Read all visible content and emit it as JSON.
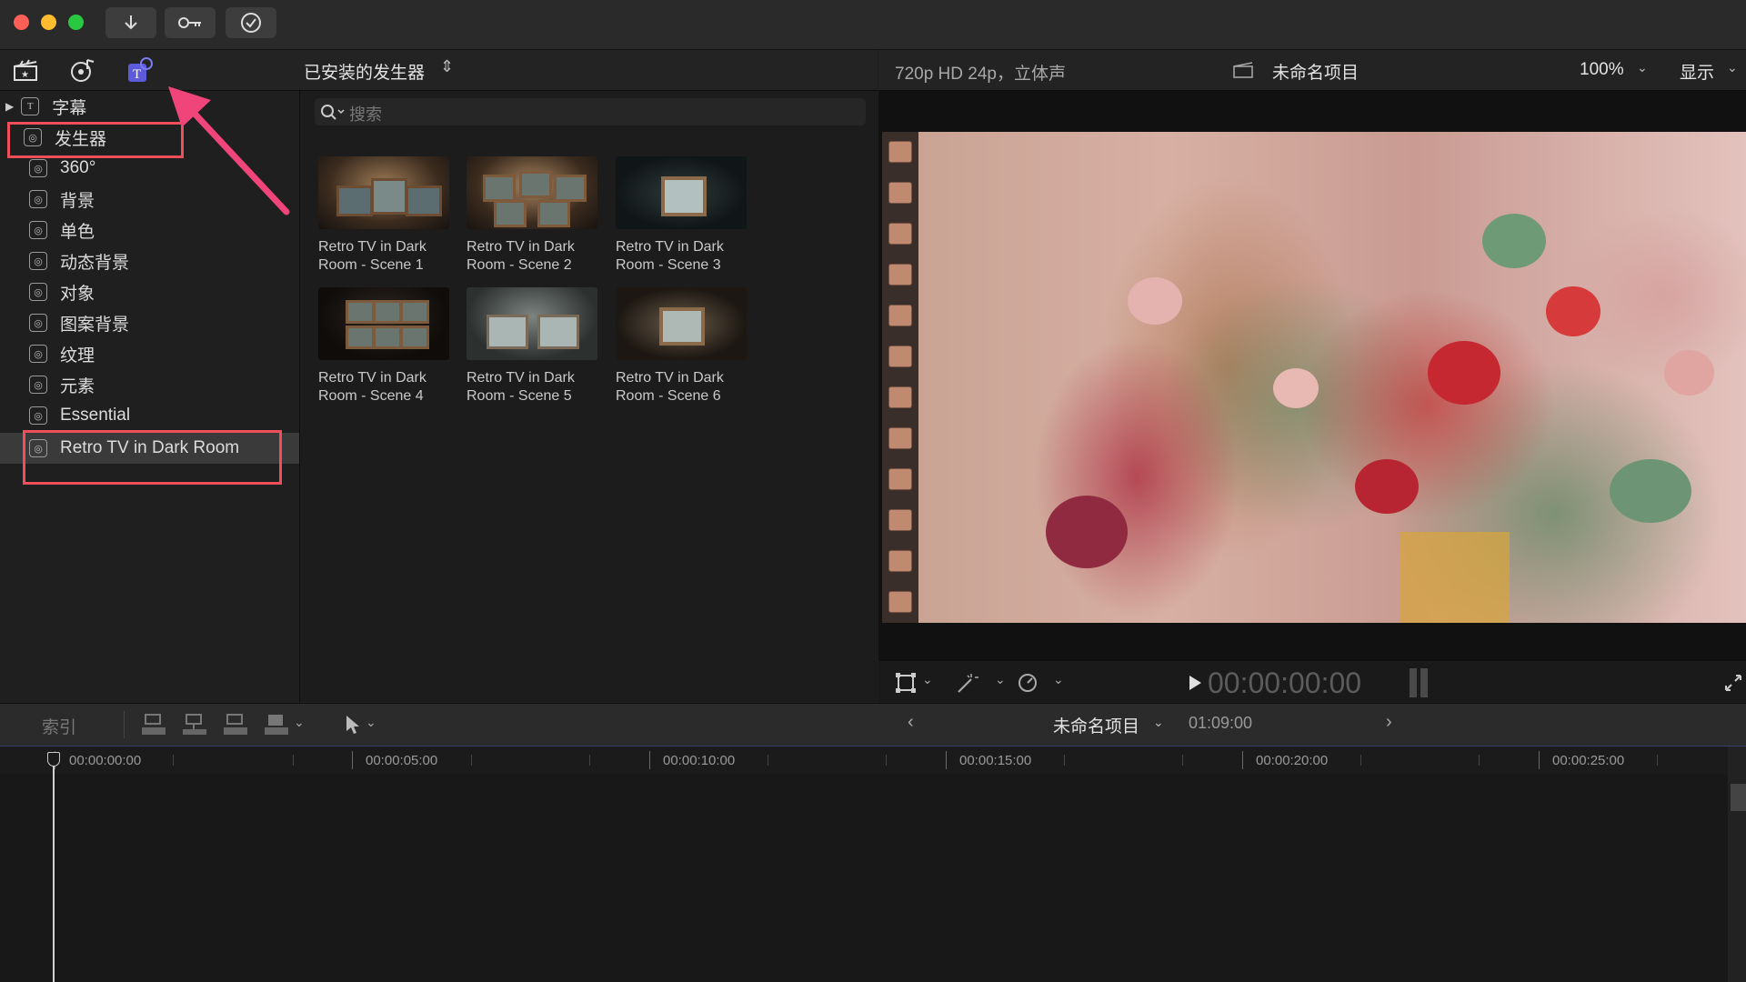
{
  "browser": {
    "title": "已安装的发生器",
    "search_placeholder": "搜索"
  },
  "sidebar": {
    "items": [
      {
        "label": "字幕"
      },
      {
        "label": "发生器"
      },
      {
        "label": "360°"
      },
      {
        "label": "背景"
      },
      {
        "label": "单色"
      },
      {
        "label": "动态背景"
      },
      {
        "label": "对象"
      },
      {
        "label": "图案背景"
      },
      {
        "label": "纹理"
      },
      {
        "label": "元素"
      },
      {
        "label": "Essential"
      },
      {
        "label": "Retro TV in Dark Room"
      }
    ]
  },
  "grid": {
    "items": [
      {
        "line1": "Retro TV in Dark",
        "line2": "Room - Scene 1"
      },
      {
        "line1": "Retro TV in Dark",
        "line2": "Room - Scene 2"
      },
      {
        "line1": "Retro TV in Dark",
        "line2": "Room - Scene 3"
      },
      {
        "line1": "Retro TV in Dark",
        "line2": "Room - Scene 4"
      },
      {
        "line1": "Retro TV in Dark",
        "line2": "Room - Scene 5"
      },
      {
        "line1": "Retro TV in Dark",
        "line2": "Room - Scene 6"
      }
    ]
  },
  "viewer": {
    "format": "720p HD 24p，立体声",
    "project": "未命名项目",
    "zoom": "100%",
    "display": "显示",
    "timecode": "00:00:00:00"
  },
  "timeline": {
    "index_label": "索引",
    "project": "未命名项目",
    "duration": "01:09:00",
    "ticks": [
      "00:00:00:00",
      "00:00:05:00",
      "00:00:10:00",
      "00:00:15:00",
      "00:00:20:00",
      "00:00:25:00"
    ]
  },
  "colors": {
    "annotation": "#ee4f5b",
    "arrow": "#f0457a",
    "accent": "#6b63e6"
  },
  "icons": [
    "download-icon",
    "key-icon",
    "checkmark-icon",
    "clapper-icon",
    "music-photo-icon",
    "titles-generators-icon",
    "search-icon",
    "play-icon",
    "transform-icon",
    "magic-wand-icon",
    "speed-icon",
    "fullscreen-icon",
    "pointer-tool-icon"
  ]
}
